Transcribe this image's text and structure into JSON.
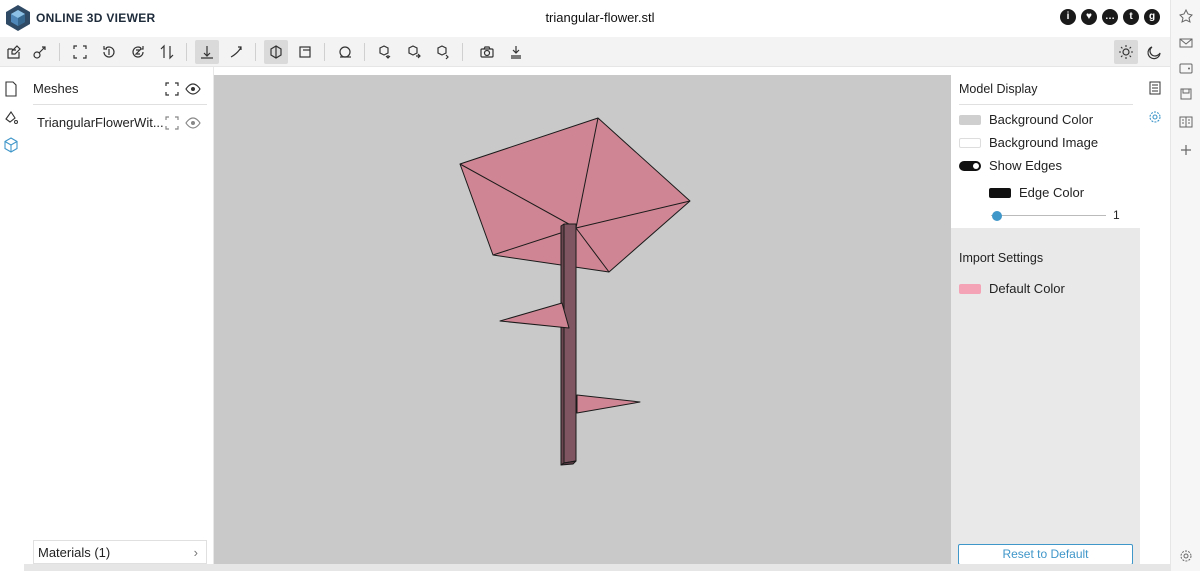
{
  "app": {
    "brand": "ONLINE 3D VIEWER",
    "file_title": "triangular-flower.stl",
    "logo_icon": "cube-logo-icon",
    "header_links": [
      "info-icon",
      "heart-icon",
      "chat-icon",
      "twitter-icon",
      "github-icon"
    ]
  },
  "toolbar": {
    "left": [
      "open-file-icon",
      "open-url-icon",
      "fit-to-window-icon",
      "set-up-y-icon",
      "set-up-z-icon",
      "flip-up-icon",
      "fixed-up-icon",
      "free-orbit-icon",
      "perspective-icon",
      "orthographic-icon",
      "measure-icon",
      "export-icon",
      "share-icon",
      "snapshot-icon",
      "download-icon",
      "print-icon"
    ],
    "right": [
      "light-mode-icon",
      "dark-mode-icon"
    ]
  },
  "left_nav": [
    "files-icon",
    "materials-icon",
    "meshes-icon"
  ],
  "meshes_panel": {
    "title": "Meshes",
    "items": [
      {
        "name": "TriangularFlowerWit..."
      }
    ],
    "materials_label": "Materials (1)"
  },
  "settings": {
    "model_display": {
      "title": "Model Display",
      "background_color_label": "Background Color",
      "background_color": "#cfcfcf",
      "background_image_label": "Background Image",
      "show_edges_label": "Show Edges",
      "show_edges": true,
      "edge_color_label": "Edge Color",
      "edge_color": "#111111",
      "edge_threshold": "1"
    },
    "import_settings": {
      "title": "Import Settings",
      "default_color_label": "Default Color",
      "default_color": "#f4a3b6"
    },
    "reset_label": "Reset to Default"
  },
  "model": {
    "petal_color": "#cf8593",
    "stem_color": "#7e5560",
    "edge_color": "#111111"
  }
}
